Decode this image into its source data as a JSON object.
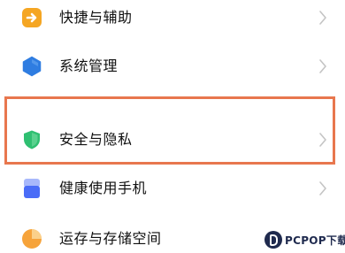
{
  "settings_items": [
    {
      "label": "快捷与辅助",
      "icon": "shortcut-arrow-icon"
    },
    {
      "label": "系统管理",
      "icon": "system-hexagon-icon"
    },
    {
      "label": "安全与隐私",
      "icon": "security-shield-icon"
    },
    {
      "label": "健康使用手机",
      "icon": "health-phone-icon"
    },
    {
      "label": "运存与存储空间",
      "icon": "storage-pie-icon"
    }
  ],
  "highlighted_item": "安全与隐私",
  "watermark": {
    "text": "PCPOP下载"
  },
  "colors": {
    "highlight_border": "#e8774e",
    "shortcut_icon": "#f5a623",
    "system_icon": "#2f7de1",
    "security_icon": "#2fbf71",
    "health_icon": "#4a6cf7",
    "storage_icon": "#f6a33a",
    "chevron": "#c4c4c4",
    "label_text": "#111111"
  }
}
